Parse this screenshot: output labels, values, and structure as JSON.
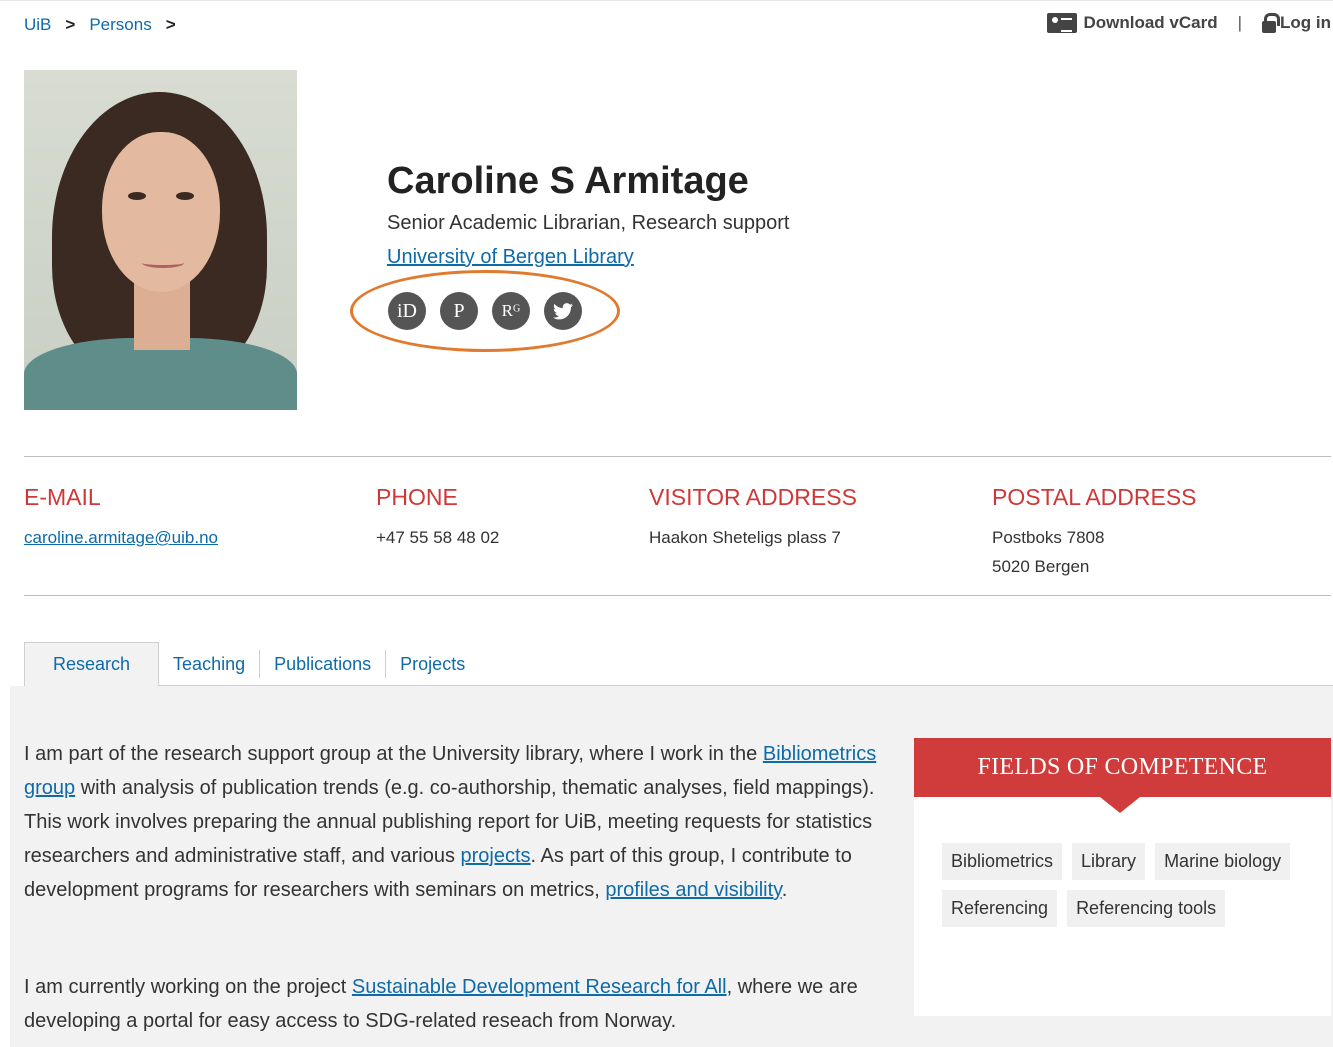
{
  "breadcrumb": {
    "items": [
      "UiB",
      "Persons"
    ],
    "separator": ">"
  },
  "util": {
    "vcard_label": "Download vCard",
    "separator": "|",
    "login_label": "Log in"
  },
  "profile": {
    "name": "Caroline S Armitage",
    "title": "Senior Academic Librarian, Research support",
    "unit": "University of Bergen Library",
    "social": [
      {
        "glyph": "iD",
        "icon": "orcid-icon"
      },
      {
        "glyph": "P",
        "icon": "publons-icon"
      },
      {
        "glyph": "Rᴳ",
        "icon": "researchgate-icon"
      },
      {
        "glyph": "🐦",
        "icon": "twitter-icon"
      }
    ]
  },
  "contact": {
    "email": {
      "heading": "E-MAIL",
      "value": "caroline.armitage@uib.no"
    },
    "phone": {
      "heading": "PHONE",
      "value": "+47 55 58 48 02"
    },
    "visitor": {
      "heading": "VISITOR ADDRESS",
      "value": "Haakon Sheteligs plass 7"
    },
    "postal": {
      "heading": "POSTAL ADDRESS",
      "line1": "Postboks 7808",
      "line2": "5020 Bergen"
    }
  },
  "tabs": [
    "Research",
    "Teaching",
    "Publications",
    "Projects"
  ],
  "research": {
    "p1": {
      "t1": "I am part of the research support group at the University library, where I work in the ",
      "link1": "Bibliometrics group",
      "t2": " with analysis of publication trends (e.g. co-authorship, thematic analyses, field mappings). This work involves preparing the annual publishing report for UiB, meeting requests for statistics researchers and administrative staff, and various ",
      "link2": "projects",
      "t3": ". As part of this group, I contribute to development programs for researchers with seminars on metrics, ",
      "link3": "profiles and visibility",
      "t4": "."
    },
    "p2": {
      "t1": "I am currently working on the project ",
      "link1": "Sustainable Development Research for All",
      "t2": ", where we are developing a portal for easy access to SDG-related reseach from Norway."
    }
  },
  "competence": {
    "heading": "FIELDS OF COMPETENCE",
    "tags": [
      "Bibliometrics",
      "Library",
      "Marine biology",
      "Referencing",
      "Referencing tools"
    ]
  },
  "colors": {
    "accent_red": "#d03737",
    "link_blue": "#0e6ba8",
    "highlight_orange": "#e07a2e"
  }
}
